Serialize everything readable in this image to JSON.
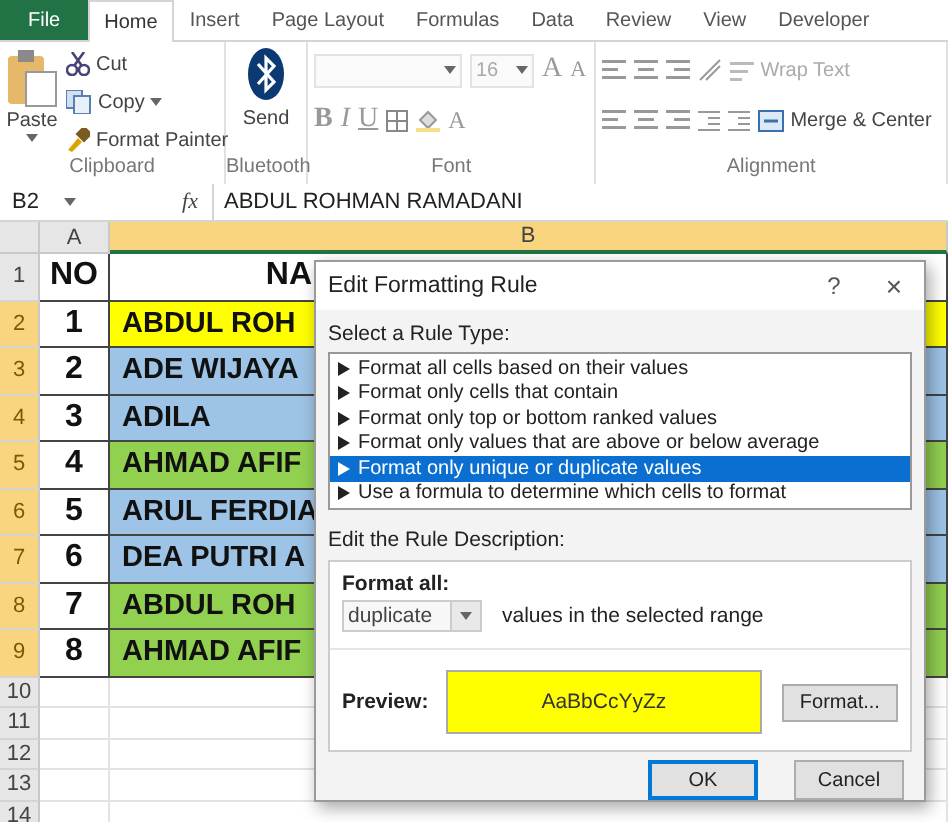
{
  "ribbon": {
    "tabs": [
      {
        "label": "File",
        "kind": "file",
        "selected": false
      },
      {
        "label": "Home",
        "kind": "tab",
        "selected": true
      },
      {
        "label": "Insert",
        "kind": "tab",
        "selected": false
      },
      {
        "label": "Page Layout",
        "kind": "tab",
        "selected": false
      },
      {
        "label": "Formulas",
        "kind": "tab",
        "selected": false
      },
      {
        "label": "Data",
        "kind": "tab",
        "selected": false
      },
      {
        "label": "Review",
        "kind": "tab",
        "selected": false
      },
      {
        "label": "View",
        "kind": "tab",
        "selected": false
      },
      {
        "label": "Developer",
        "kind": "tab",
        "selected": false
      }
    ],
    "clipboard": {
      "paste": "Paste",
      "cut": "Cut",
      "copy": "Copy",
      "format_painter": "Format Painter",
      "label": "Clipboard"
    },
    "bluetooth": {
      "send": "Send",
      "label": "Bluetooth"
    },
    "font": {
      "size": "16",
      "grow": "A",
      "shrink": "A",
      "bold": "B",
      "italic": "I",
      "underline": "U",
      "font_color": "A",
      "label": "Font"
    },
    "alignment": {
      "wrap_text": "Wrap Text",
      "merge_center": "Merge & Center",
      "label": "Alignment"
    }
  },
  "formula_bar": {
    "cell": "B2",
    "function_label": "fx",
    "formula": "ABDUL ROHMAN RAMADANI"
  },
  "sheet": {
    "columns": [
      {
        "label": "A",
        "highlighted": false
      },
      {
        "label": "B",
        "highlighted": true
      }
    ],
    "rows": [
      {
        "number": "1",
        "highlighted": false,
        "no": "NO",
        "name": "NA",
        "kind": "header"
      },
      {
        "number": "2",
        "highlighted": true,
        "no": "1",
        "name": "ABDUL ROH",
        "color": "#ffff00",
        "kind": "data"
      },
      {
        "number": "3",
        "highlighted": true,
        "no": "2",
        "name": "ADE WIJAYA",
        "color": "#9dc3e6",
        "kind": "data"
      },
      {
        "number": "4",
        "highlighted": true,
        "no": "3",
        "name": "ADILA",
        "color": "#9dc3e6",
        "kind": "data"
      },
      {
        "number": "5",
        "highlighted": true,
        "no": "4",
        "name": "AHMAD AFIF",
        "color": "#92d050",
        "kind": "data"
      },
      {
        "number": "6",
        "highlighted": true,
        "no": "5",
        "name": "ARUL FERDIA",
        "color": "#9dc3e6",
        "kind": "data"
      },
      {
        "number": "7",
        "highlighted": true,
        "no": "6",
        "name": "DEA PUTRI A",
        "color": "#9dc3e6",
        "kind": "data"
      },
      {
        "number": "8",
        "highlighted": true,
        "no": "7",
        "name": "ABDUL ROH",
        "color": "#92d050",
        "kind": "data"
      },
      {
        "number": "9",
        "highlighted": true,
        "no": "8",
        "name": "AHMAD AFIF",
        "color": "#92d050",
        "kind": "data"
      },
      {
        "number": "10",
        "highlighted": false,
        "kind": "empty"
      },
      {
        "number": "11",
        "highlighted": false,
        "kind": "empty"
      },
      {
        "number": "12",
        "highlighted": false,
        "kind": "empty"
      },
      {
        "number": "13",
        "highlighted": false,
        "kind": "empty"
      },
      {
        "number": "14",
        "highlighted": false,
        "kind": "empty"
      }
    ]
  },
  "dialog": {
    "title": "Edit Formatting Rule",
    "help": "?",
    "close": "×",
    "rule_type_label": "Select a Rule Type:",
    "rule_types": [
      {
        "label": "Format all cells based on their values",
        "selected": false
      },
      {
        "label": "Format only cells that contain",
        "selected": false
      },
      {
        "label": "Format only top or bottom ranked values",
        "selected": false
      },
      {
        "label": "Format only values that are above or below average",
        "selected": false
      },
      {
        "label": "Format only unique or duplicate values",
        "selected": true
      },
      {
        "label": "Use a formula to determine which cells to format",
        "selected": false
      }
    ],
    "description_label": "Edit the Rule Description:",
    "format_all_label": "Format all:",
    "format_all_value": "duplicate",
    "range_text": "values in the selected range",
    "preview_label": "Preview:",
    "preview_text": "AaBbCcYyZz",
    "format_button": "Format...",
    "buttons": [
      {
        "label": "OK",
        "default": true
      },
      {
        "label": "Cancel",
        "default": false
      }
    ]
  }
}
